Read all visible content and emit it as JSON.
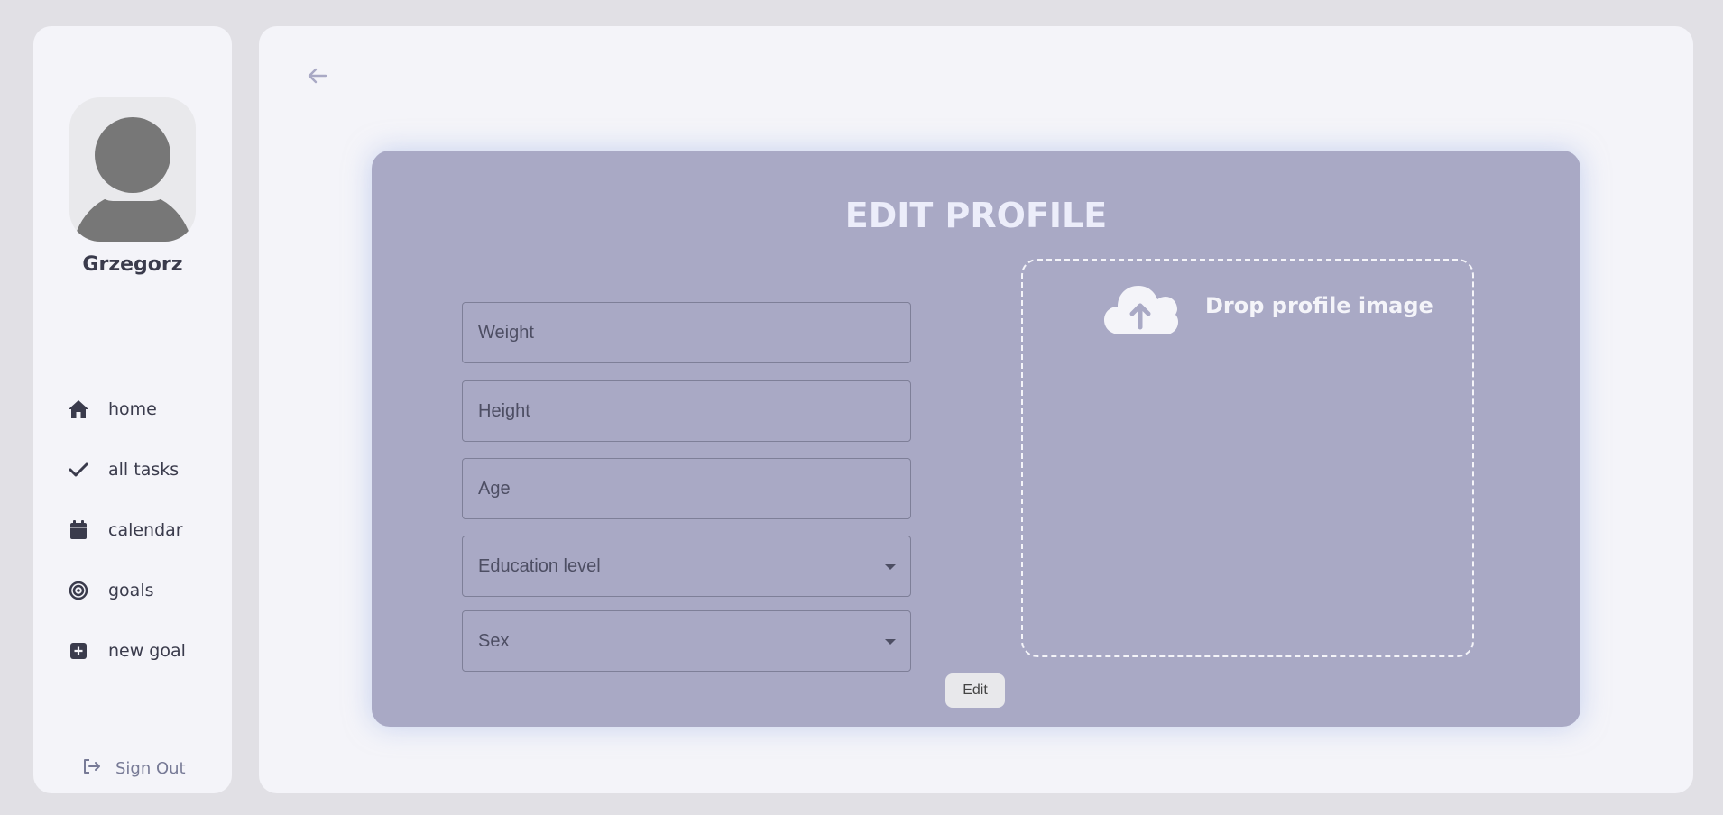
{
  "user": {
    "name": "Grzegorz"
  },
  "nav": {
    "items": [
      {
        "label": "home",
        "icon": "home-icon"
      },
      {
        "label": "all tasks",
        "icon": "check-icon"
      },
      {
        "label": "calendar",
        "icon": "calendar-icon"
      },
      {
        "label": "goals",
        "icon": "target-icon"
      },
      {
        "label": "new goal",
        "icon": "plus-square-icon"
      }
    ],
    "signout_label": "Sign Out"
  },
  "form": {
    "title": "EDIT PROFILE",
    "weight_placeholder": "Weight",
    "height_placeholder": "Height",
    "age_placeholder": "Age",
    "education_placeholder": "Education level",
    "sex_placeholder": "Sex",
    "dropzone_label": "Drop profile image",
    "submit_label": "Edit"
  },
  "colors": {
    "background": "#e1e0e5",
    "panel": "#f4f4f9",
    "card": "#a9a9c5",
    "text_dark": "#3a3b4c"
  }
}
